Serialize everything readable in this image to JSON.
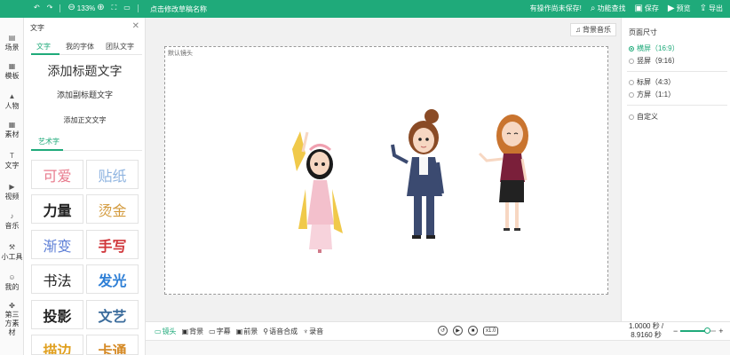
{
  "toolbar": {
    "undo_icon": "undo-icon",
    "redo_icon": "redo-icon",
    "zoom_level": "133%",
    "project_title": "点击修改草稿名称",
    "unsaved_status": "有操作尚未保存!",
    "find_feature": "功能查找",
    "save": "保存",
    "preview": "预览",
    "export": "导出"
  },
  "leftnav": {
    "items": [
      {
        "label": "场景",
        "icon": "scene-icon"
      },
      {
        "label": "模板",
        "icon": "template-icon"
      },
      {
        "label": "人物",
        "icon": "person-icon"
      },
      {
        "label": "素材",
        "icon": "material-icon"
      },
      {
        "label": "文字",
        "icon": "text-icon"
      },
      {
        "label": "视频",
        "icon": "video-icon"
      },
      {
        "label": "音乐",
        "icon": "music-icon"
      },
      {
        "label": "小工具",
        "icon": "tool-icon"
      },
      {
        "label": "我的",
        "icon": "my-icon"
      },
      {
        "label": "第三方素材",
        "icon": "third-party-icon"
      }
    ]
  },
  "textpanel": {
    "title": "文字",
    "tabs": [
      "文字",
      "我的字体",
      "团队文字"
    ],
    "heading": "添加标题文字",
    "subheading": "添加副标题文字",
    "body": "添加正文文字",
    "art_tab": "艺术字",
    "art_tiles": [
      {
        "text": "可爱",
        "color": "#e87a8c"
      },
      {
        "text": "贴纸",
        "color": "#8fb4e0"
      },
      {
        "text": "力量",
        "color": "#222222"
      },
      {
        "text": "烫金",
        "color": "#d39a3c"
      },
      {
        "text": "渐变",
        "color": "#5e7fd6"
      },
      {
        "text": "手写",
        "color": "#d0363a"
      },
      {
        "text": "书法",
        "color": "#222222"
      },
      {
        "text": "发光",
        "color": "#2e7fd6"
      },
      {
        "text": "投影",
        "color": "#222222"
      },
      {
        "text": "文艺",
        "color": "#3b6c9c"
      },
      {
        "text": "描边",
        "color": "#e0a020"
      },
      {
        "text": "卡通",
        "color": "#d58a26"
      }
    ]
  },
  "canvas": {
    "bgm_button": "背景音乐",
    "stage_label": "默认镜头"
  },
  "rightpanel": {
    "title": "页面尺寸",
    "options": [
      {
        "label": "横屏（16:9）",
        "selected": true
      },
      {
        "label": "竖屏（9:16）",
        "selected": false
      },
      {
        "label": "标屏（4:3）",
        "selected": false
      },
      {
        "label": "方屏（1:1）",
        "selected": false
      },
      {
        "label": "自定义",
        "selected": false
      }
    ]
  },
  "timeline": {
    "tabs": [
      "镜头",
      "背景",
      "字幕",
      "前景",
      "语音合成",
      "录音"
    ],
    "speed": "x1.0",
    "current_time": "1.0000 秒 /",
    "total_time": "8.9160 秒",
    "zoom_level_fraction": 0.75
  },
  "colors": {
    "accent": "#1faa7a"
  }
}
